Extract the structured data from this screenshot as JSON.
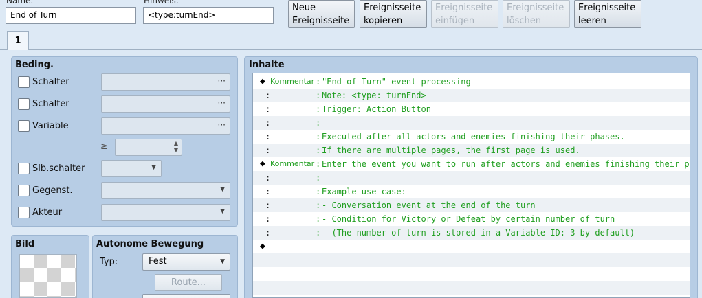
{
  "header": {
    "name_label": "Name:",
    "name_value": "End of Turn",
    "note_label": "Hinweis:",
    "note_value": "<type:turnEnd>"
  },
  "toolbar": {
    "new_page_line1": "Neue",
    "new_page_line2": "Ereignisseite",
    "copy_line1": "Ereignisseite",
    "copy_line2": "kopieren",
    "paste_line1": "Ereignisseite",
    "paste_line2": "einfügen",
    "delete_line1": "Ereignisseite",
    "delete_line2": "löschen",
    "clear_line1": "Ereignisseite",
    "clear_line2": "leeren"
  },
  "tabs": [
    {
      "label": "1"
    }
  ],
  "conditions": {
    "title": "Beding.",
    "switch1_label": "Schalter",
    "switch2_label": "Schalter",
    "variable_label": "Variable",
    "gte_symbol": "≥",
    "self_switch_label": "Slb.schalter",
    "item_label": "Gegenst.",
    "actor_label": "Akteur",
    "dots": "···"
  },
  "image": {
    "title": "Bild"
  },
  "autonomous": {
    "title": "Autonome Bewegung",
    "type_label": "Typ:",
    "type_value": "Fest",
    "route_label": "Route..."
  },
  "contents": {
    "title": "Inhalte",
    "rows": [
      {
        "mark": "◆",
        "type": "Kommentar",
        "text": "\"End of Turn\" event processing"
      },
      {
        "mark": ":",
        "type": "",
        "text": "Note: <type: turnEnd>"
      },
      {
        "mark": ":",
        "type": "",
        "text": "Trigger: Action Button"
      },
      {
        "mark": ":",
        "type": "",
        "text": ""
      },
      {
        "mark": ":",
        "type": "",
        "text": "Executed after all actors and enemies finishing their phases."
      },
      {
        "mark": ":",
        "type": "",
        "text": "If there are multiple pages, the first page is used."
      },
      {
        "mark": "◆",
        "type": "Kommentar",
        "text": "Enter the event you want to run after actors and enemies finishing their phases"
      },
      {
        "mark": ":",
        "type": "",
        "text": ""
      },
      {
        "mark": ":",
        "type": "",
        "text": "Example use case:"
      },
      {
        "mark": ":",
        "type": "",
        "text": "- Conversation event at the end of the turn"
      },
      {
        "mark": ":",
        "type": "",
        "text": "- Condition for Victory or Defeat by certain number of turn"
      },
      {
        "mark": ":",
        "type": "",
        "text": "  (The number of turn is stored in a Variable ID: 3 by default)"
      },
      {
        "mark": "◆",
        "type": "",
        "text": ""
      }
    ]
  }
}
